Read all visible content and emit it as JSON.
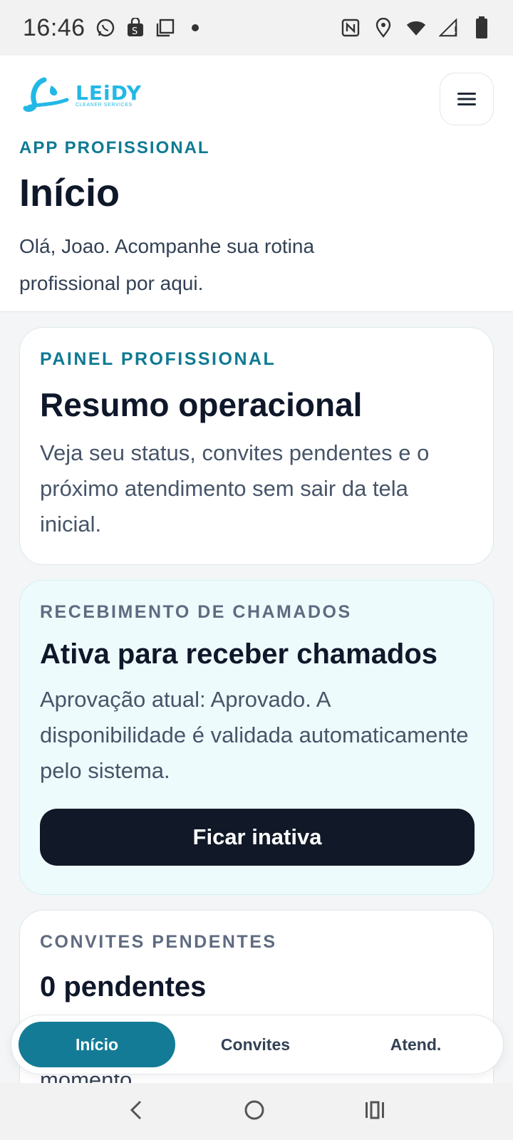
{
  "status_bar": {
    "time": "16:46",
    "left_icons": [
      "whatsapp-icon",
      "shopping-bag-icon",
      "copy-icon",
      "dot-icon"
    ],
    "right_icons": [
      "nfc-icon",
      "location-icon",
      "wifi-icon",
      "signal-icon",
      "battery-icon"
    ]
  },
  "header": {
    "logo": {
      "word": "LEiDY",
      "sub": "CLEANER SERVICES"
    },
    "eyebrow": "APP PROFISSIONAL",
    "title": "Início",
    "subtitle": "Olá, Joao. Acompanhe sua rotina profissional por aqui."
  },
  "cards": {
    "panel": {
      "eyebrow": "PAINEL PROFISSIONAL",
      "title": "Resumo operacional",
      "text": "Veja seu status, convites pendentes e o próximo atendimento sem sair da tela inicial."
    },
    "calls": {
      "eyebrow": "RECEBIMENTO DE CHAMADOS",
      "title": "Ativa para receber chamados",
      "text": "Aprovação atual: Aprovado. A disponibilidade é validada automaticamente pelo sistema.",
      "button": "Ficar inativa"
    },
    "invites": {
      "eyebrow": "CONVITES PENDENTES",
      "title": "0 pendentes",
      "peek_text": "momento"
    }
  },
  "tabs": [
    {
      "label": "Início",
      "active": true
    },
    {
      "label": "Convites",
      "active": false
    },
    {
      "label": "Atend.",
      "active": false
    }
  ],
  "colors": {
    "accent": "#137b96",
    "brand": "#22b8e6",
    "dark_button": "#111827",
    "tint_card": "#eefbfc"
  }
}
